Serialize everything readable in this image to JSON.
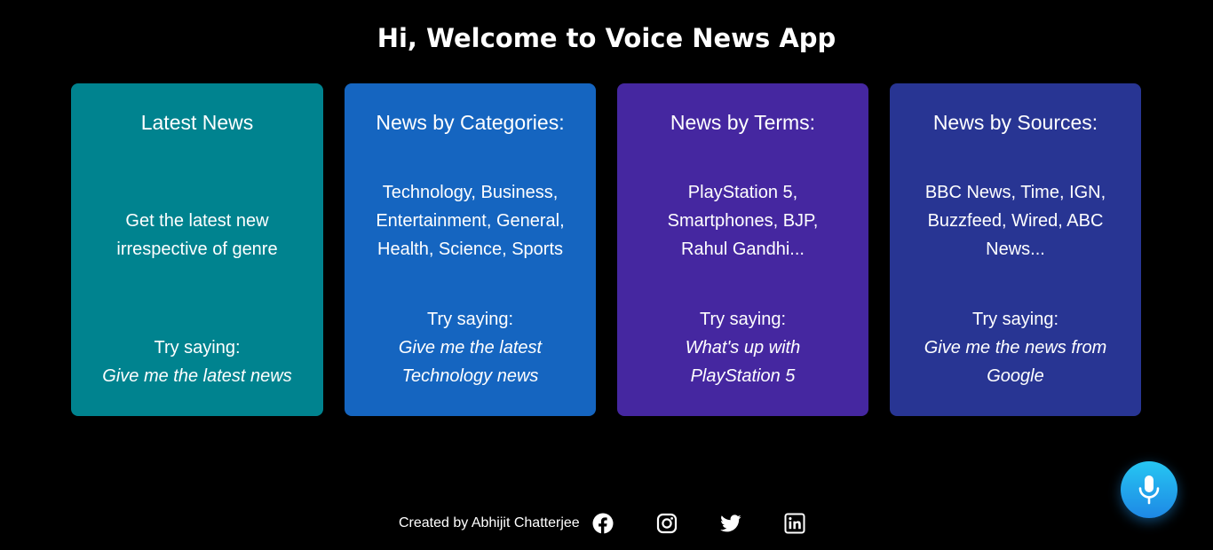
{
  "header": {
    "title": "Hi, Welcome to Voice News App"
  },
  "cards": [
    {
      "title": "Latest News",
      "description": [
        "Get the latest new",
        "irrespective of genre"
      ],
      "try_label": "Try saying:",
      "example": [
        "Give me the latest news"
      ],
      "color": "#00838f"
    },
    {
      "title": "News by Categories:",
      "description": [
        "Technology, Business,",
        "Entertainment, General,",
        "Health, Science, Sports"
      ],
      "try_label": "Try saying:",
      "example": [
        "Give me the latest",
        "Technology news"
      ],
      "color": "#1565c0"
    },
    {
      "title": "News by Terms:",
      "description": [
        "PlayStation 5,",
        "Smartphones, BJP,",
        "Rahul Gandhi..."
      ],
      "try_label": "Try saying:",
      "example": [
        "What's up with",
        "PlayStation 5"
      ],
      "color": "#4527a0"
    },
    {
      "title": "News by Sources:",
      "description": [
        "BBC News, Time, IGN,",
        "Buzzfeed, Wired, ABC",
        "News..."
      ],
      "try_label": "Try saying:",
      "example": [
        "Give me the news from",
        "Google"
      ],
      "color": "#283593"
    }
  ],
  "footer": {
    "credit": "Created by Abhijit Chatterjee",
    "social_icons": [
      "facebook-icon",
      "instagram-icon",
      "twitter-icon",
      "linkedin-icon"
    ]
  },
  "mic": {
    "icon": "microphone-icon",
    "color": "#1e9bf0"
  }
}
